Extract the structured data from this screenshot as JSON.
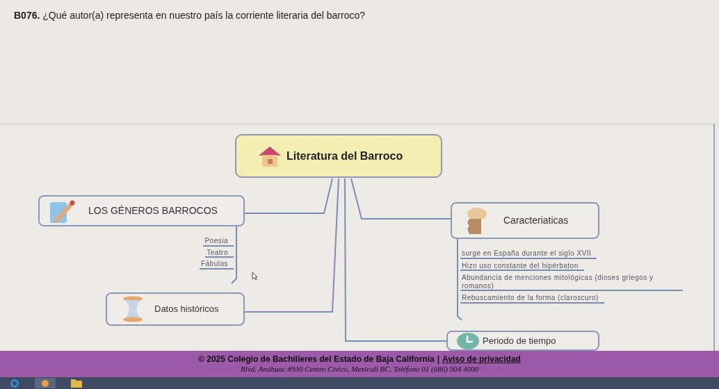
{
  "question": {
    "number": "B076.",
    "text": "¿Qué autor(a) representa en nuestro país la corriente literaria del barroco?"
  },
  "mindmap": {
    "root": "Literatura del Barroco",
    "branches": [
      {
        "label": "LOS GÉNEROS BARROCOS",
        "children": [
          "Poesia",
          "Teatro",
          "Fábulas"
        ]
      },
      {
        "label": "Datos históricos"
      },
      {
        "label": "Caracteriaticas",
        "children": [
          "surge en España durante el siglo XVII",
          "Hizo uso constante del hipérbaton",
          "Abundancia de menciones mitológicas (dioses griegos y romanos)",
          "Rebuscamiento de la forma (claroscuro)"
        ]
      },
      {
        "label": "Periodo de tiempo"
      }
    ]
  },
  "footer": {
    "copyright": "© 2025 Colegio de Bachilleres del Estado de Baja California",
    "separator": "|",
    "link": "Aviso de privacidad",
    "address": "Blvd. Anáhuac #930 Centro Cívico, Mexicali BC. Teléfono 01 (686) 904 4000"
  }
}
